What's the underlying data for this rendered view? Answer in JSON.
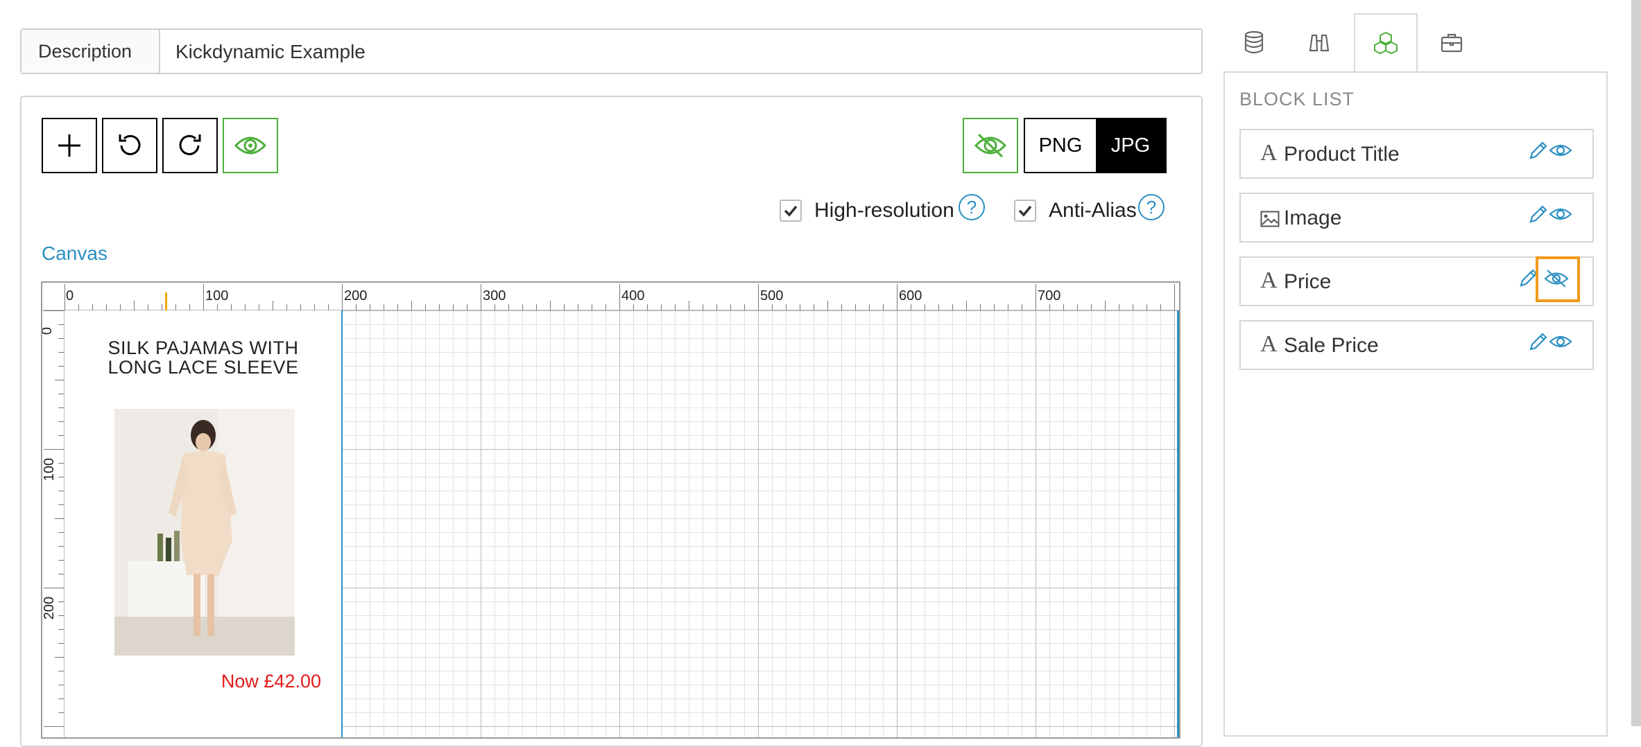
{
  "description": {
    "label": "Description",
    "value": "Kickdynamic Example"
  },
  "toolbar": {
    "add_icon": "plus-icon",
    "undo_icon": "undo-icon",
    "redo_icon": "redo-icon",
    "preview_icon": "eye-icon",
    "hide_icon": "eye-slash-icon",
    "formats": [
      "PNG",
      "JPG"
    ],
    "selected_format": "JPG",
    "accent_color": "#4caf3a"
  },
  "options": {
    "high_resolution": {
      "label": "High-resolution",
      "checked": true,
      "help": "?"
    },
    "anti_alias": {
      "label": "Anti-Alias",
      "checked": true,
      "help": "?"
    }
  },
  "canvas": {
    "label": "Canvas",
    "ruler_top": [
      "0",
      "100",
      "200",
      "300",
      "400",
      "500",
      "600",
      "700"
    ],
    "ruler_left": [
      "0",
      "100",
      "200"
    ],
    "banner": {
      "title_line1": "SILK PAJAMAS WITH",
      "title_line2": "LONG LACE SLEEVE",
      "price": "Now £42.00",
      "price_color": "#e41b1b"
    }
  },
  "sidebar": {
    "tabs": [
      {
        "icon": "database-icon",
        "active": false
      },
      {
        "icon": "binoculars-icon",
        "active": false
      },
      {
        "icon": "cubes-icon",
        "active": true
      },
      {
        "icon": "briefcase-icon",
        "active": false
      }
    ],
    "heading": "BLOCK LIST",
    "blocks": [
      {
        "label": "Product Title",
        "icon": "text-icon",
        "visible": true
      },
      {
        "label": "Image",
        "icon": "image-icon",
        "visible": true
      },
      {
        "label": "Price",
        "icon": "text-icon",
        "visible": false
      },
      {
        "label": "Sale Price",
        "icon": "text-icon",
        "visible": true
      }
    ],
    "accent_color": "#2a8fc1",
    "highlight_color": "#f19a1a"
  }
}
